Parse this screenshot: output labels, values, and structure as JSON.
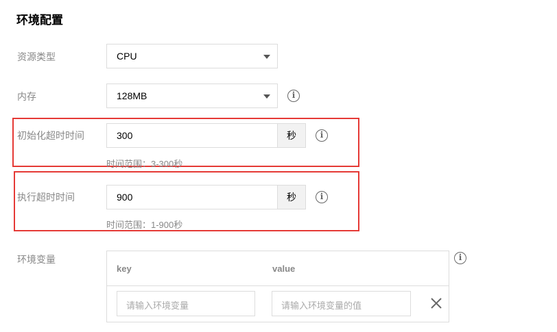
{
  "section": {
    "title": "环境配置"
  },
  "resource_type": {
    "label": "资源类型",
    "value": "CPU"
  },
  "memory": {
    "label": "内存",
    "value": "128MB"
  },
  "init_timeout": {
    "label": "初始化超时时间",
    "value": "300",
    "unit": "秒",
    "hint": "时间范围：3-300秒"
  },
  "exec_timeout": {
    "label": "执行超时时间",
    "value": "900",
    "unit": "秒",
    "hint": "时间范围：1-900秒"
  },
  "env_vars": {
    "label": "环境变量",
    "key_header": "key",
    "value_header": "value",
    "key_placeholder": "请输入环境变量",
    "value_placeholder": "请输入环境变量的值"
  },
  "icons": {
    "info": "info-icon",
    "close": "close-icon",
    "dropdown": "chevron-down-icon"
  },
  "colors": {
    "highlight_border": "#e53935",
    "label": "#888888",
    "unit_bg": "#f2f2f2"
  }
}
